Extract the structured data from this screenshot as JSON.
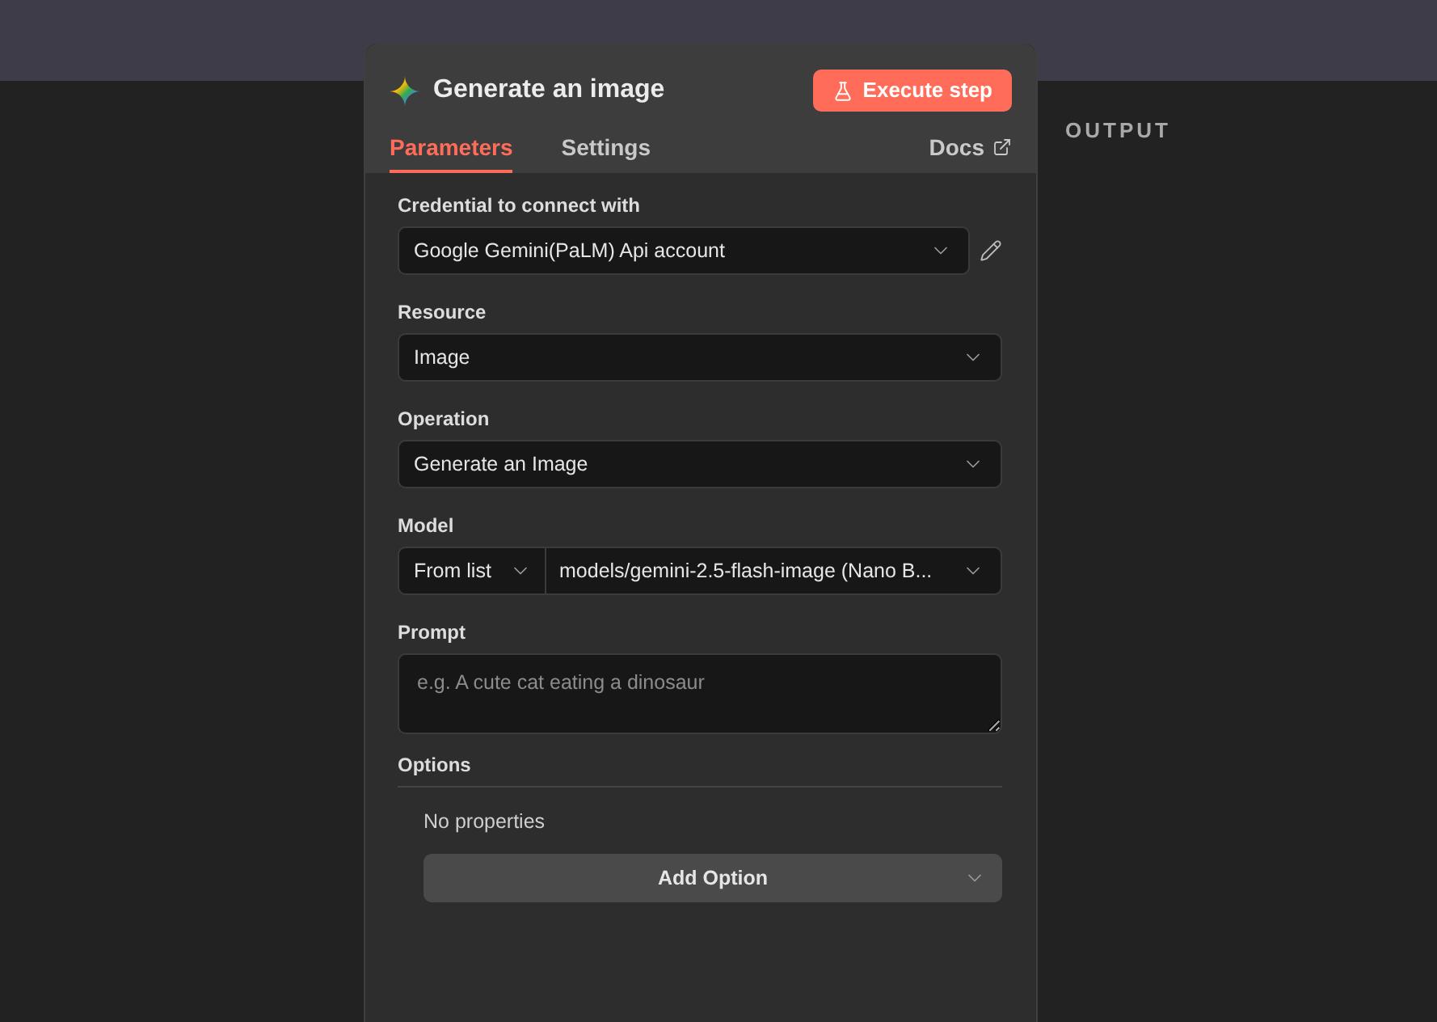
{
  "output_label": "OUTPUT",
  "panel": {
    "title": "Generate an image",
    "execute_button": "Execute step",
    "tabs": [
      {
        "label": "Parameters",
        "selected": true
      },
      {
        "label": "Settings",
        "selected": false
      }
    ],
    "docs_link": "Docs"
  },
  "fields": [
    {
      "kind": "select",
      "label": "Credential to connect with",
      "value": "Google Gemini(PaLM) Api account",
      "editable": true
    },
    {
      "kind": "select",
      "label": "Resource",
      "value": "Image",
      "editable": false
    },
    {
      "kind": "select",
      "label": "Operation",
      "value": "Generate an Image",
      "editable": false
    },
    {
      "kind": "split_select",
      "label": "Model",
      "mode": "From list",
      "value": "models/gemini-2.5-flash-image (Nano B...",
      "editable": false
    },
    {
      "kind": "textarea",
      "label": "Prompt",
      "placeholder": "e.g. A cute cat eating a dinosaur",
      "editable": false
    }
  ],
  "options": {
    "title": "Options",
    "empty_text": "No properties",
    "add_button": "Add Option"
  }
}
